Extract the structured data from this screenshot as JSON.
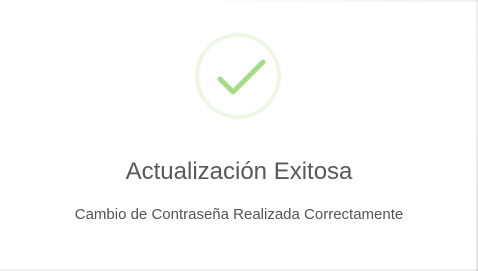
{
  "dialog": {
    "icon": "success-check-icon",
    "icon_color": "#a5dc86",
    "icon_ring_color": "#eef7e6",
    "title": "Actualización Exitosa",
    "message": "Cambio de Contraseña Realizada Correctamente",
    "text_color": "#595959"
  }
}
